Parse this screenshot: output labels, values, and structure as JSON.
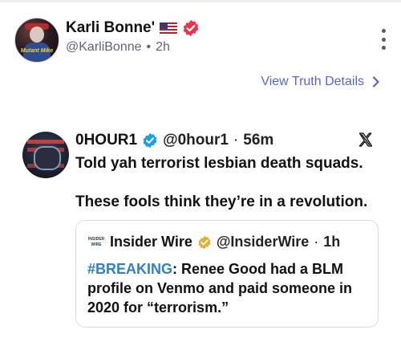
{
  "post": {
    "author_name": "Karli Bonne'",
    "author_handle": "@KarliBonne",
    "separator": "•",
    "timestamp": "2h",
    "avatar_text": "Mutant Mike",
    "view_details_label": "View Truth Details"
  },
  "embedded": {
    "name": "0HOUR1",
    "handle": "@0hour1",
    "dot": "·",
    "time": "56m",
    "line1": "Told yah terrorist lesbian death squads.",
    "line2": "These fools think they’re in a revolution."
  },
  "quote": {
    "logo_text_1": "INSIDER",
    "logo_text_2": "WIRE",
    "name": "Insider Wire",
    "handle": "@InsiderWire",
    "dot": "·",
    "time": "1h",
    "hashtag": "#BREAKING",
    "text": ": Renee Good had a BLM profile on Venmo and paid someone in 2020 for “terrorism.”"
  },
  "colors": {
    "link": "#5b63c9",
    "hashtag": "#2f80c8",
    "verified_red": "#e8364b",
    "verified_blue": "#1d9bf0",
    "verified_gold": "#e2b13c"
  },
  "icons": {
    "more": "vertical-ellipsis",
    "chevron": "chevron-right",
    "platform": "x-logo"
  }
}
